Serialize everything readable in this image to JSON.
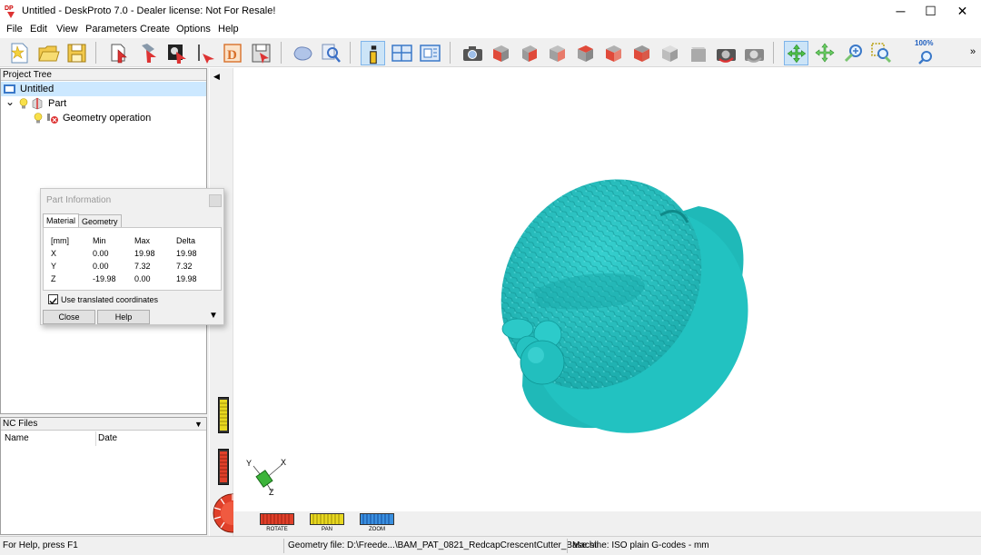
{
  "window": {
    "title": "Untitled - DeskProto 7.0 - Dealer license: Not For Resale!",
    "minimize": "─",
    "maximize": "☐",
    "close": "✕"
  },
  "menu": [
    "File",
    "Edit",
    "View",
    "Parameters",
    "Create",
    "Options",
    "Help"
  ],
  "toolbar": {
    "zoom_label": "100%",
    "more": "»"
  },
  "project_tree": {
    "header": "Project Tree",
    "root": "Untitled",
    "part": "Part",
    "operation": "Geometry operation",
    "expand_glyph": "⌄"
  },
  "nc_files": {
    "header": "NC Files",
    "dropdown": "▼",
    "columns": [
      "Name",
      "Date"
    ]
  },
  "part_information": {
    "title": "Part Information",
    "tabs": [
      "Material",
      "Geometry"
    ],
    "unit": "[mm]",
    "columns": [
      "Min",
      "Max",
      "Delta"
    ],
    "rows": [
      {
        "axis": "X",
        "min": "0.00",
        "max": "19.98",
        "delta": "19.98"
      },
      {
        "axis": "Y",
        "min": "0.00",
        "max": "7.32",
        "delta": "7.32"
      },
      {
        "axis": "Z",
        "min": "-19.98",
        "max": "0.00",
        "delta": "19.98"
      }
    ],
    "checkbox_label": "Use translated coordinates",
    "checkbox_checked": true,
    "close_button": "Close",
    "help_button": "Help",
    "expand": "▼"
  },
  "viewport": {
    "collapse": "◀",
    "axes": {
      "x": "X",
      "y": "Y",
      "z": "Z"
    },
    "model_color": "#21c4c4",
    "modes": [
      "ROTATE",
      "PAN",
      "ZOOM"
    ]
  },
  "status": {
    "help": "For Help, press F1",
    "geometry_file": "Geometry file: D:\\Freede...\\BAM_PAT_0821_RedcapCrescentCutter_Base.stl",
    "machine": "Machine: ISO plain G-codes - mm"
  }
}
